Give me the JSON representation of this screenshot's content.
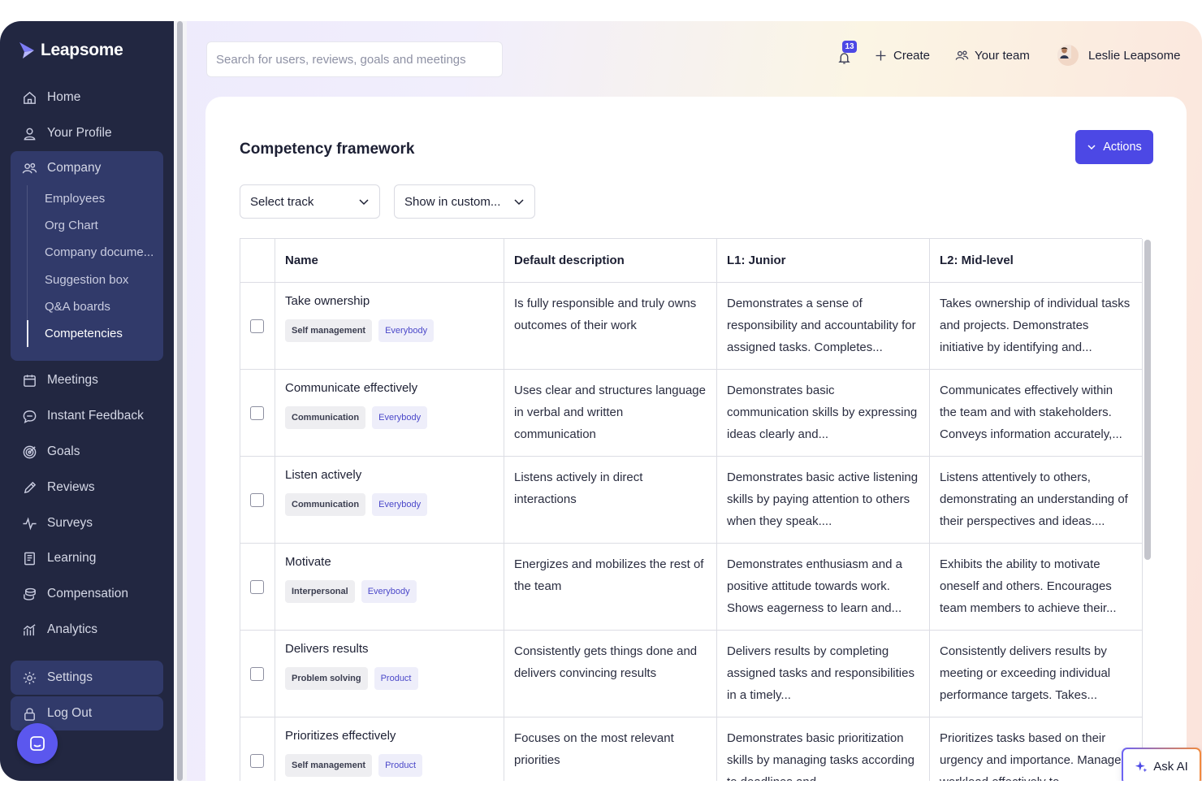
{
  "brand": {
    "name": "Leapsome"
  },
  "sidebar": {
    "items": [
      {
        "label": "Home",
        "icon": "home-icon"
      },
      {
        "label": "Your Profile",
        "icon": "user-icon"
      },
      {
        "label": "Company",
        "icon": "users-icon"
      },
      {
        "label": "Meetings",
        "icon": "calendar-icon"
      },
      {
        "label": "Instant Feedback",
        "icon": "chat-icon"
      },
      {
        "label": "Goals",
        "icon": "target-icon"
      },
      {
        "label": "Reviews",
        "icon": "pencil-icon"
      },
      {
        "label": "Surveys",
        "icon": "pulse-icon"
      },
      {
        "label": "Learning",
        "icon": "book-icon"
      },
      {
        "label": "Compensation",
        "icon": "coins-icon"
      },
      {
        "label": "Analytics",
        "icon": "analytics-icon"
      }
    ],
    "company_sub": [
      "Employees",
      "Org Chart",
      "Company docume...",
      "Suggestion box",
      "Q&A boards",
      "Competencies"
    ],
    "active_sub": "Competencies",
    "settings": "Settings",
    "logout": "Log Out"
  },
  "topbar": {
    "search_placeholder": "Search for users, reviews, goals and meetings",
    "notification_count": "13",
    "create": "Create",
    "your_team": "Your team",
    "user_name": "Leslie Leapsome"
  },
  "page": {
    "title": "Competency framework",
    "actions": "Actions",
    "select_track": "Select track",
    "show_in": "Show in custom..."
  },
  "table": {
    "headers": [
      "Name",
      "Default description",
      "L1: Junior",
      "L2: Mid-level"
    ],
    "rows": [
      {
        "name": "Take ownership",
        "tag1": "Self management",
        "tag2": "Everybody",
        "desc": "Is fully responsible and truly owns outcomes of their work",
        "l1": "Demonstrates a sense of responsibility and accountability for assigned tasks. Completes...",
        "l2": "Takes ownership of individual tasks and projects. Demonstrates initiative by identifying and..."
      },
      {
        "name": "Communicate effectively",
        "tag1": "Communication",
        "tag2": "Everybody",
        "desc": "Uses clear and structures language in verbal and written communication",
        "l1": "Demonstrates basic communication skills by expressing ideas clearly and...",
        "l2": "Communicates effectively within the team and with stakeholders. Conveys information accurately,..."
      },
      {
        "name": "Listen actively",
        "tag1": "Communication",
        "tag2": "Everybody",
        "desc": "Listens actively in direct interactions",
        "l1": "Demonstrates basic active listening skills by paying attention to others when they speak....",
        "l2": "Listens attentively to others, demonstrating an understanding of their perspectives and ideas...."
      },
      {
        "name": "Motivate",
        "tag1": "Interpersonal",
        "tag2": "Everybody",
        "desc": "Energizes and mobilizes the rest of the team",
        "l1": "Demonstrates enthusiasm and a positive attitude towards work. Shows eagerness to learn and...",
        "l2": "Exhibits the ability to motivate oneself and others. Encourages team members to achieve their..."
      },
      {
        "name": "Delivers results",
        "tag1": "Problem solving",
        "tag2": "Product",
        "desc": "Consistently gets things done and delivers convincing results",
        "l1": "Delivers results by completing assigned tasks and responsibilities in a timely...",
        "l2": "Consistently delivers results by meeting or exceeding individual performance targets. Takes..."
      },
      {
        "name": "Prioritizes effectively",
        "tag1": "Self management",
        "tag2": "Product",
        "desc": "Focuses on the most relevant priorities",
        "l1": "Demonstrates basic prioritization skills by managing tasks according to deadlines and...",
        "l2": "Prioritizes tasks based on their urgency and importance. Manages workload effectively to..."
      }
    ]
  },
  "ask_ai": "Ask AI",
  "colors": {
    "sidebar": "#222741",
    "accent": "#4c48e5",
    "active_group": "#313a6a"
  }
}
